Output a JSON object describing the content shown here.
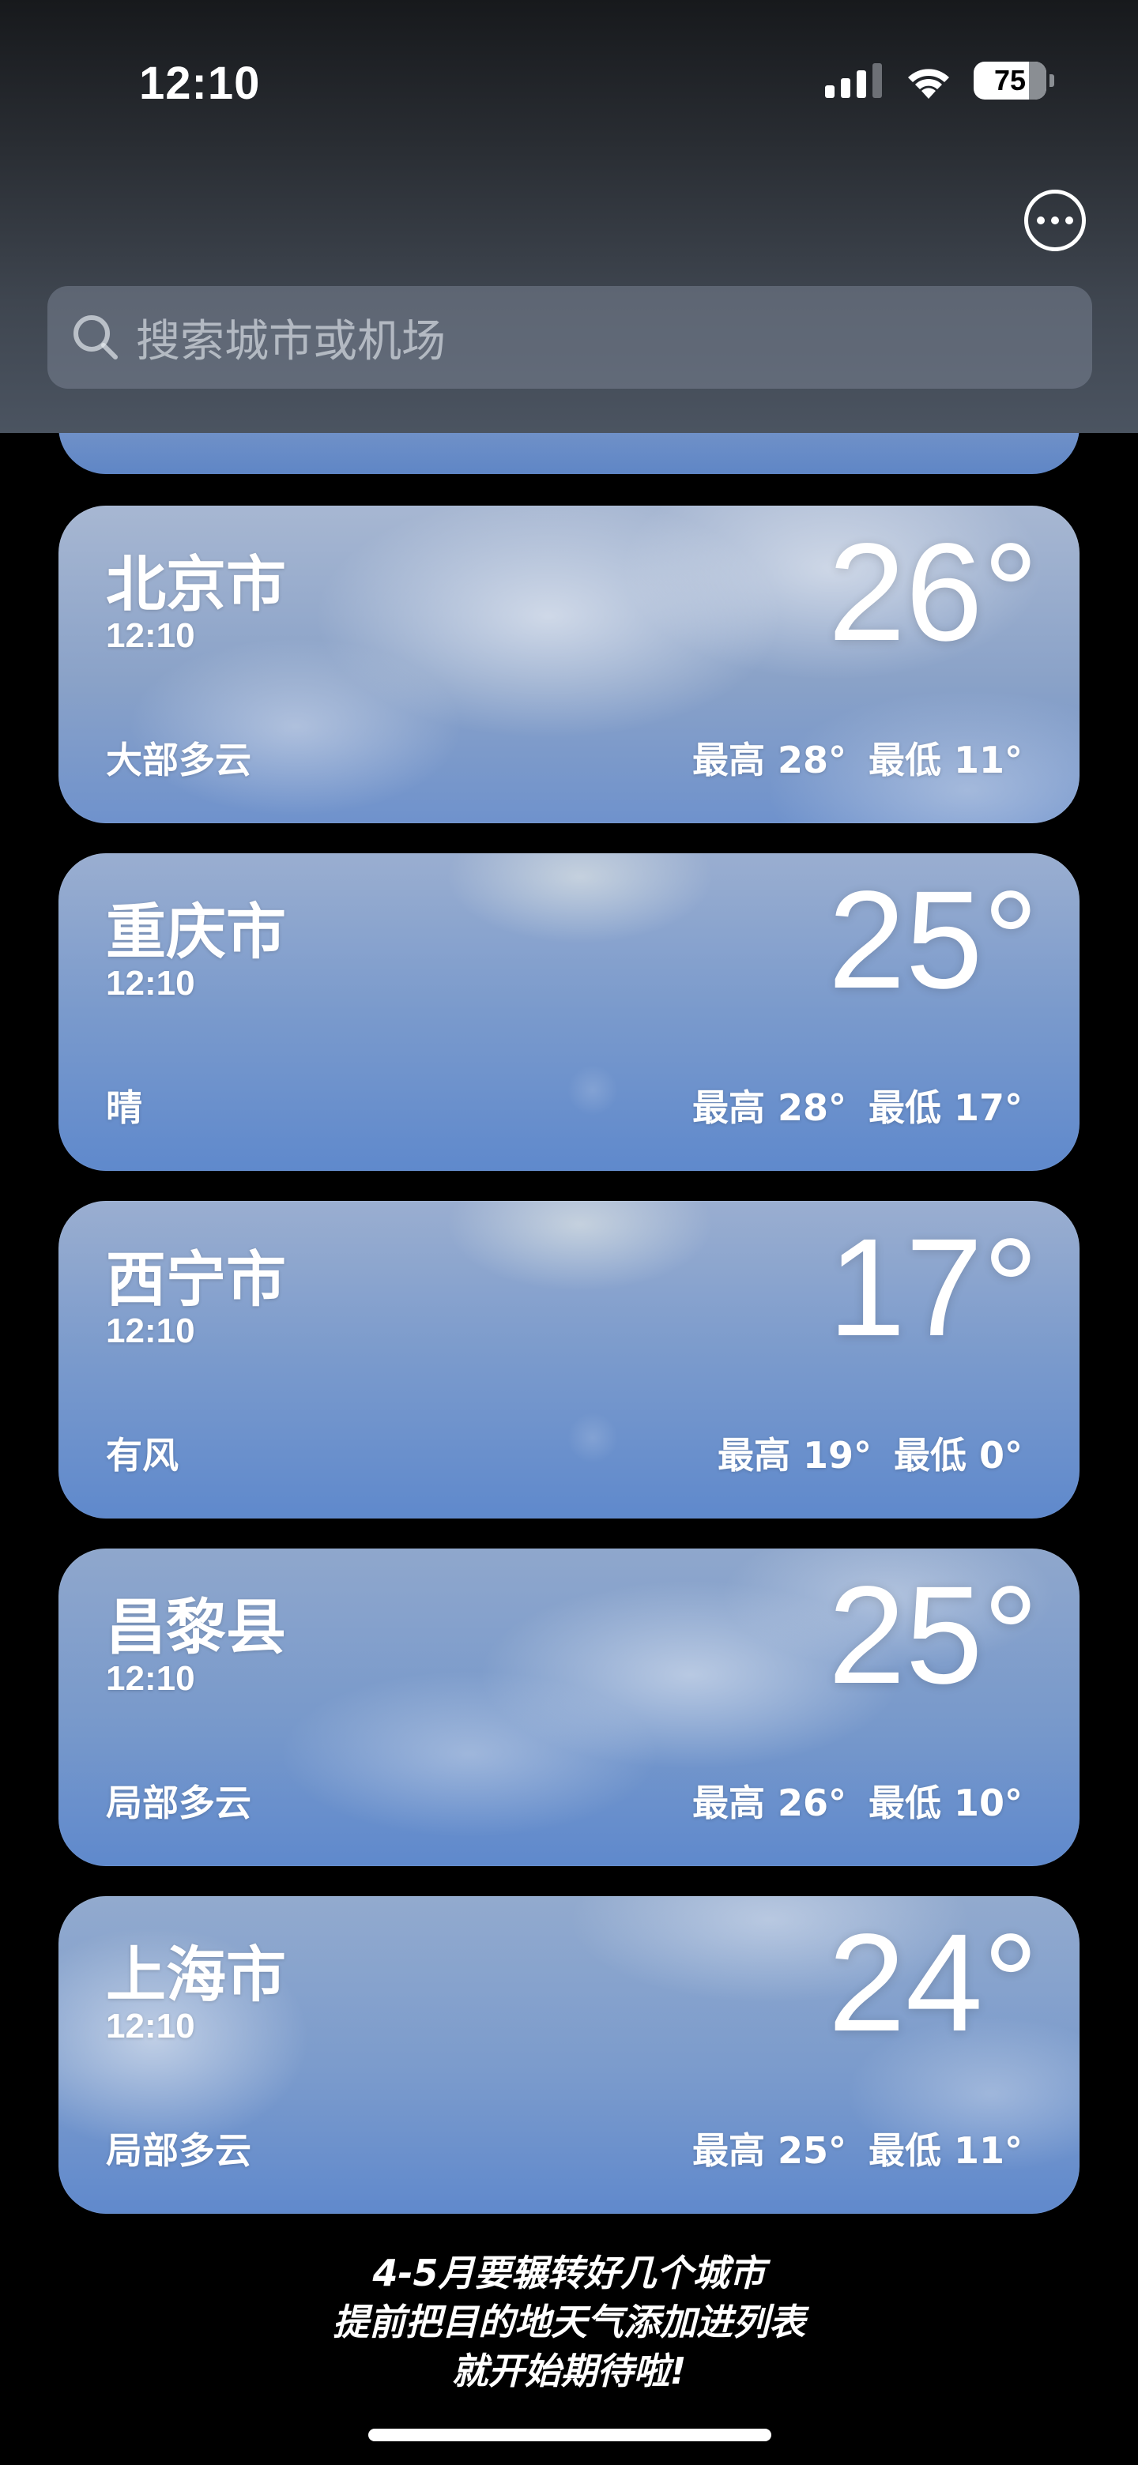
{
  "status_bar": {
    "time": "12:10",
    "battery": "75"
  },
  "search": {
    "placeholder": "搜索城市或机场"
  },
  "cities": [
    {
      "name": "北京市",
      "time": "12:10",
      "temp": "26°",
      "condition": "大部多云",
      "high": "最高 28°",
      "low": "最低 11°"
    },
    {
      "name": "重庆市",
      "time": "12:10",
      "temp": "25°",
      "condition": "晴",
      "high": "最高 28°",
      "low": "最低 17°"
    },
    {
      "name": "西宁市",
      "time": "12:10",
      "temp": "17°",
      "condition": "有风",
      "high": "最高 19°",
      "low": "最低 0°"
    },
    {
      "name": "昌黎县",
      "time": "12:10",
      "temp": "25°",
      "condition": "局部多云",
      "high": "最高 26°",
      "low": "最低 10°"
    },
    {
      "name": "上海市",
      "time": "12:10",
      "temp": "24°",
      "condition": "局部多云",
      "high": "最高 25°",
      "low": "最低 11°"
    }
  ],
  "footer": {
    "line1": "4-5月要辗转好几个城市",
    "line2": "提前把目的地天气添加进列表",
    "line3": "就开始期待啦!"
  }
}
